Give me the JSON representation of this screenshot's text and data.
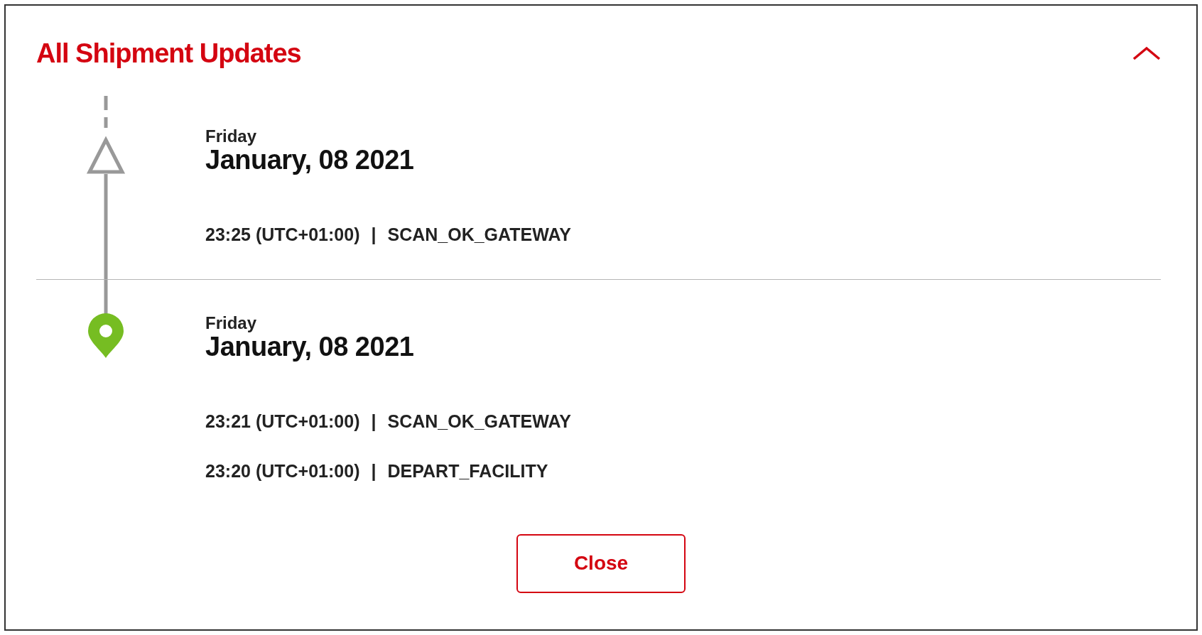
{
  "title": "All Shipment Updates",
  "expanded": true,
  "groups": [
    {
      "kind": "triangle",
      "day": "Friday",
      "date": "January, 08 2021",
      "events": [
        {
          "time": "23:25 (UTC+01:00)",
          "separator": "|",
          "status": "SCAN_OK_GATEWAY"
        }
      ]
    },
    {
      "kind": "pin",
      "day": "Friday",
      "date": "January, 08 2021",
      "events": [
        {
          "time": "23:21 (UTC+01:00)",
          "separator": "|",
          "status": "SCAN_OK_GATEWAY"
        },
        {
          "time": "23:20 (UTC+01:00)",
          "separator": "|",
          "status": "DEPART_FACILITY"
        }
      ]
    }
  ],
  "close_button": "Close"
}
